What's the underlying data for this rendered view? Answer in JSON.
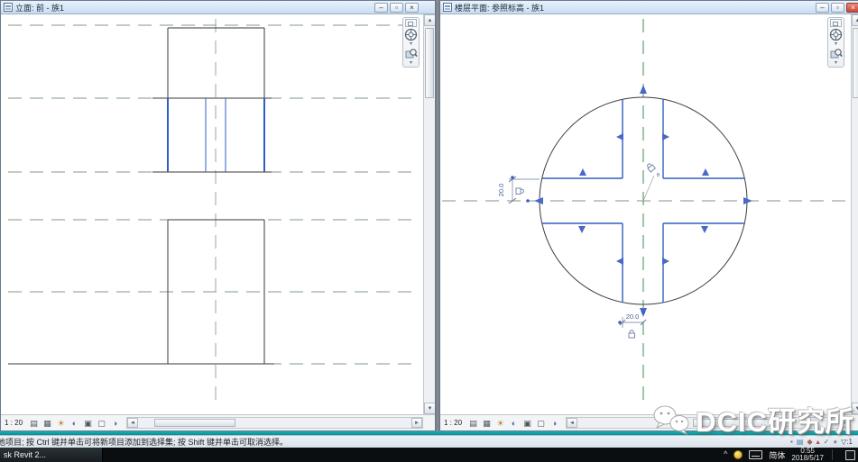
{
  "windows": {
    "left": {
      "title": "立面: 前 - 族1",
      "scale": "1 : 20"
    },
    "right": {
      "title": "楼层平面: 参照标高 - 族1",
      "scale": "1 : 20"
    }
  },
  "dims": {
    "left": "20.0",
    "bottom": "20.0",
    "lock_sub": "B"
  },
  "status_bar": {
    "message": "他项目; 按 Ctrl 键并单击可将新项目添加到选择集; 按 Shift 键并单击可取消选择。",
    "selection_count": "1"
  },
  "taskbar": {
    "app_button": "sk Revit 2...",
    "ime_label": "简体",
    "time": "0:55",
    "date": "2018/5/17"
  },
  "watermark": {
    "text": "DCIC研究所"
  },
  "glyphs": {
    "minimize": "–",
    "restore": "▫",
    "close": "×",
    "scroll_up": "▲",
    "scroll_down": "▼",
    "scroll_left": "◄",
    "scroll_right": "►",
    "dropdown": "▾",
    "detail_level": "▤",
    "visual_style": "▦",
    "sun_path": "☀",
    "shadows": "◐",
    "crop_view": "▣",
    "show_crop": "▢",
    "hide_isolate": "◑",
    "status_1": "▪",
    "status_2": "▤",
    "status_3": "◆",
    "status_4": "▴",
    "status_5": "✓",
    "status_6": "●",
    "filter": "▽",
    "tray_chevron": "^"
  },
  "colors": {
    "selection_blue": "#2f5fc0",
    "reference_green": "#3e8e52",
    "teal_accent": "#0fa8a8"
  }
}
